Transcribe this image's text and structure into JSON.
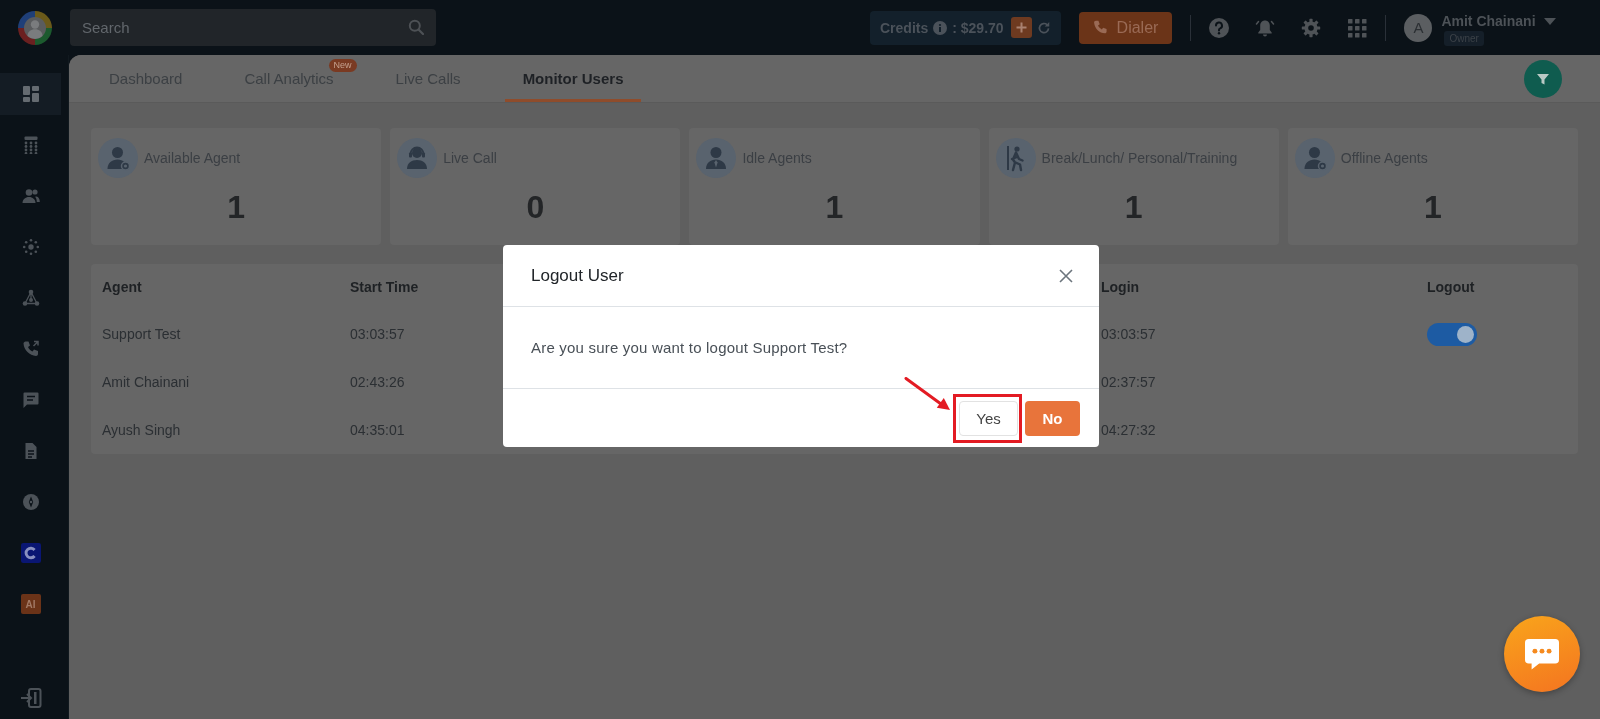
{
  "topbar": {
    "search": {
      "placeholder": "Search"
    },
    "credits": {
      "label": "Credits",
      "amount": ": $29.70"
    },
    "dialer": {
      "label": "Dialer"
    },
    "user": {
      "initial": "A",
      "name": "Amit Chainani",
      "role": "Owner"
    }
  },
  "sidebar": {
    "items": [
      {
        "kind": "dashboard",
        "selected": true
      },
      {
        "kind": "keypad",
        "selected": false
      },
      {
        "kind": "users",
        "selected": false
      },
      {
        "kind": "hub",
        "selected": false
      },
      {
        "kind": "network",
        "selected": false
      },
      {
        "kind": "phone",
        "selected": false
      },
      {
        "kind": "chat",
        "selected": false
      },
      {
        "kind": "document",
        "selected": false
      },
      {
        "kind": "compass",
        "selected": false
      },
      {
        "kind": "c-logo",
        "selected": false
      },
      {
        "kind": "text",
        "label": "AI",
        "selected": false
      }
    ],
    "footer": {
      "kind": "exit"
    }
  },
  "tabs": [
    {
      "label": "Dashboard",
      "selected": false
    },
    {
      "label": "Call Analytics",
      "badge": "New",
      "selected": false
    },
    {
      "label": "Live Calls",
      "selected": false
    },
    {
      "label": "Monitor Users",
      "selected": true
    }
  ],
  "stats": [
    {
      "kind": "available",
      "label": "Available Agent",
      "value": "1"
    },
    {
      "kind": "live",
      "label": "Live Call",
      "value": "0"
    },
    {
      "kind": "idle",
      "label": "Idle Agents",
      "value": "1"
    },
    {
      "kind": "break",
      "label": "Break/Lunch/ Personal/Training",
      "value": "1"
    },
    {
      "kind": "offline",
      "label": "Offline Agents",
      "value": "1"
    }
  ],
  "table": {
    "columns": [
      "Agent",
      "Start Time",
      "Login",
      "Logout"
    ],
    "rows": [
      {
        "cells": [
          "Support Test",
          "03:03:57",
          "03:03:57"
        ],
        "logout": {
          "on": true
        }
      },
      {
        "cells": [
          "Amit Chainani",
          "02:43:26",
          "02:37:57"
        ]
      },
      {
        "cells": [
          "Ayush Singh",
          "04:35:01",
          "04:27:32"
        ]
      }
    ]
  },
  "modal": {
    "title": "Logout User",
    "message": "Are you sure you want to logout Support Test?",
    "buttons": [
      {
        "kind": "secondary",
        "label": "Yes",
        "highlighted": true
      },
      {
        "kind": "primary",
        "label": "No",
        "highlighted": false
      }
    ]
  }
}
